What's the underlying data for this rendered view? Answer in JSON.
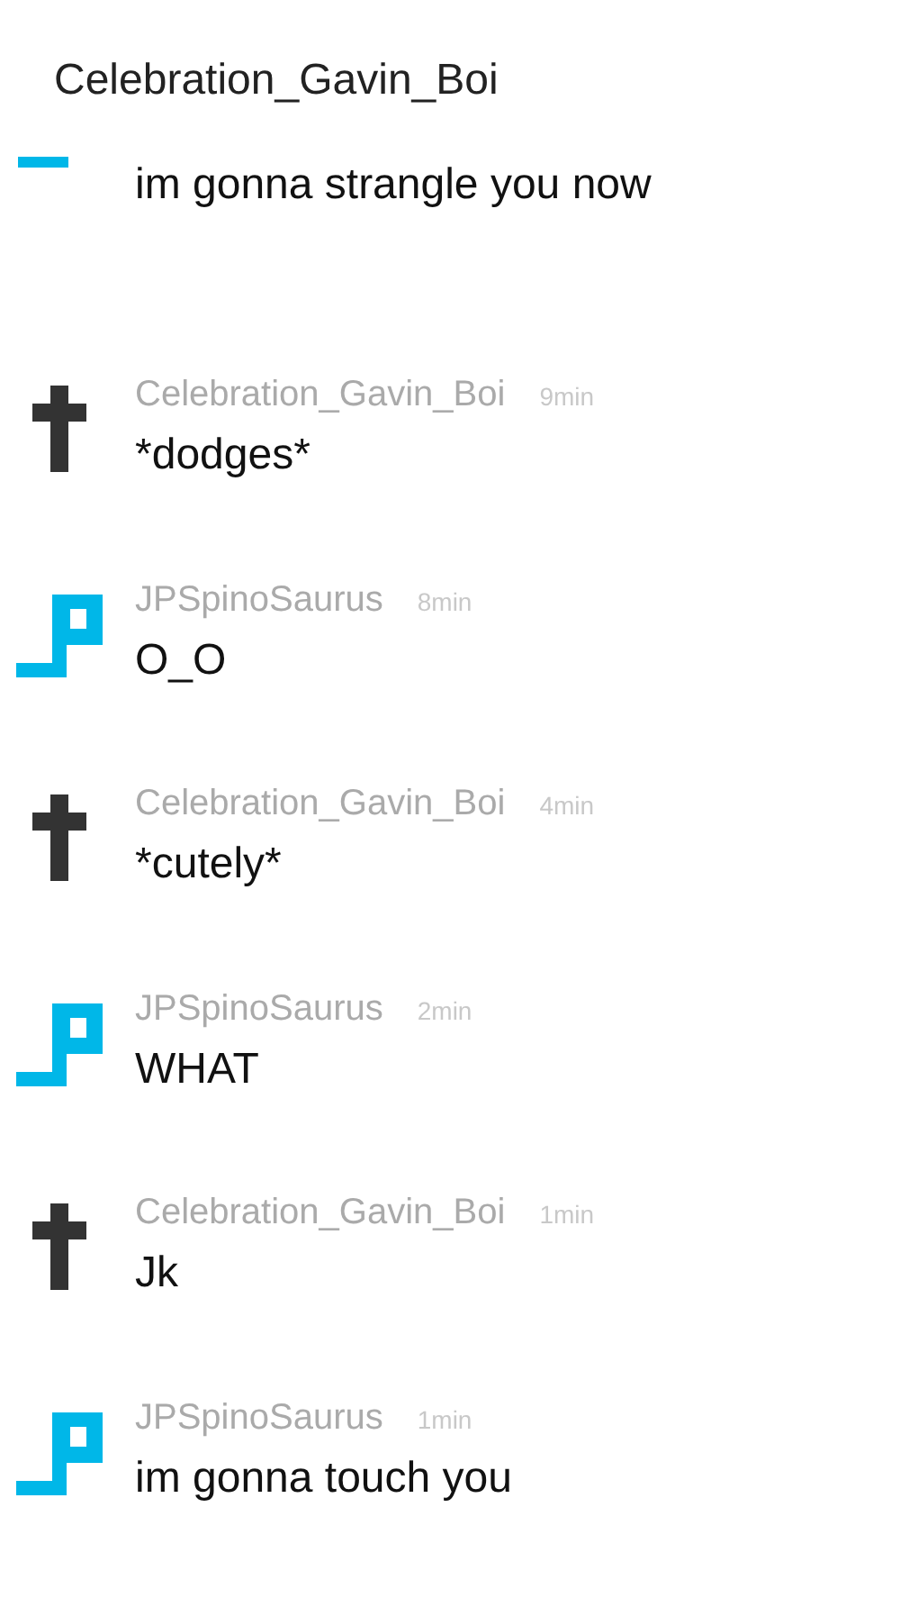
{
  "header": {
    "title": "Celebration_Gavin_Boi"
  },
  "messages": [
    {
      "kind": "partial",
      "text": "im gonna strangle you now"
    },
    {
      "kind": "cross",
      "author": "Celebration_Gavin_Boi",
      "time": "9min",
      "text": "*dodges*"
    },
    {
      "kind": "pixel",
      "author": "JPSpinoSaurus",
      "time": "8min",
      "text": "O_O"
    },
    {
      "kind": "cross",
      "author": "Celebration_Gavin_Boi",
      "time": "4min",
      "text": "*cutely*"
    },
    {
      "kind": "pixel",
      "author": "JPSpinoSaurus",
      "time": "2min",
      "text": "WHAT"
    },
    {
      "kind": "cross",
      "author": "Celebration_Gavin_Boi",
      "time": "1min",
      "text": "Jk"
    },
    {
      "kind": "pixel",
      "author": "JPSpinoSaurus",
      "time": "1min",
      "text": "im gonna touch you"
    }
  ]
}
